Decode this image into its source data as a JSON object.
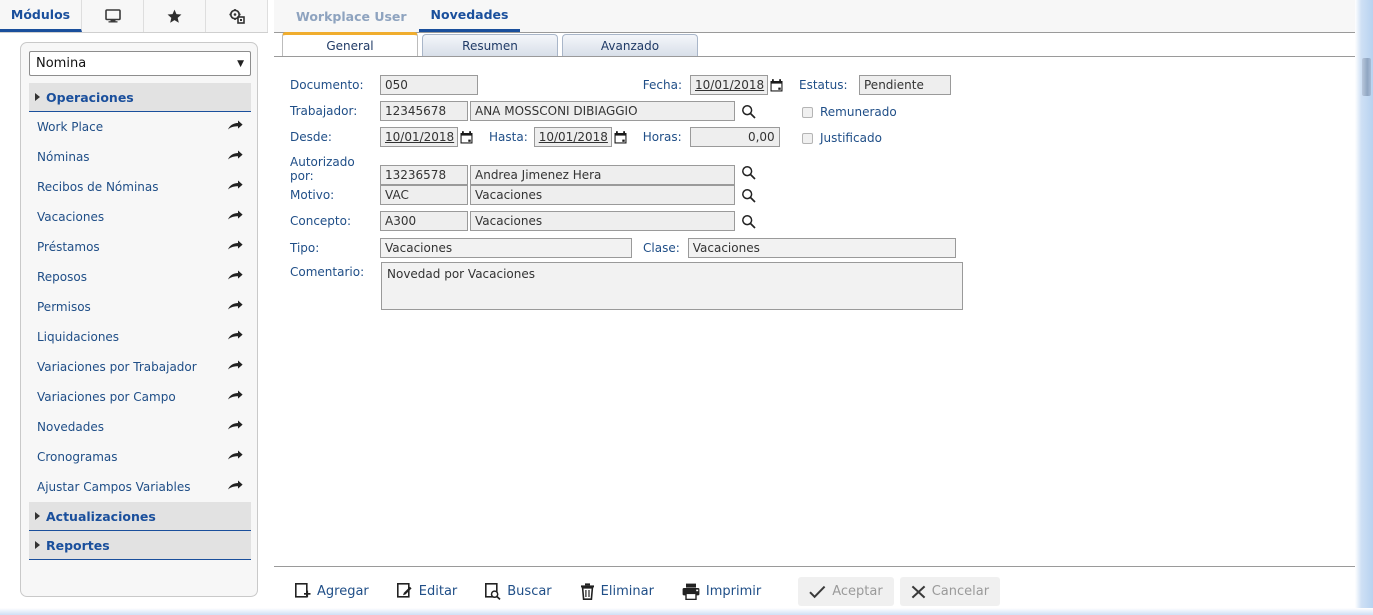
{
  "sidebar": {
    "tabs": [
      {
        "label": "Módulos",
        "icon": "modules-text",
        "active": true
      },
      {
        "label": "",
        "icon": "monitor-icon",
        "active": false
      },
      {
        "label": "",
        "icon": "star-icon",
        "active": false
      },
      {
        "label": "",
        "icon": "gears-icon",
        "active": false
      }
    ],
    "module_select": {
      "value": "Nomina",
      "caret": "▼"
    },
    "groups": [
      {
        "label": "Operaciones",
        "expanded": true
      },
      {
        "label": "Actualizaciones",
        "expanded": false
      },
      {
        "label": "Reportes",
        "expanded": false
      }
    ],
    "items": [
      {
        "label": "Work Place"
      },
      {
        "label": "Nóminas"
      },
      {
        "label": "Recibos de Nóminas"
      },
      {
        "label": "Vacaciones"
      },
      {
        "label": "Préstamos"
      },
      {
        "label": "Reposos"
      },
      {
        "label": "Permisos"
      },
      {
        "label": "Liquidaciones"
      },
      {
        "label": "Variaciones por Trabajador"
      },
      {
        "label": "Variaciones por Campo"
      },
      {
        "label": "Novedades"
      },
      {
        "label": "Cronogramas"
      },
      {
        "label": "Ajustar Campos Variables"
      }
    ]
  },
  "breadcrumbs": [
    {
      "label": "Workplace User",
      "active": false
    },
    {
      "label": "Novedades",
      "active": true
    }
  ],
  "tabs": [
    {
      "label": "General",
      "active": true
    },
    {
      "label": "Resumen",
      "active": false
    },
    {
      "label": "Avanzado",
      "active": false
    }
  ],
  "form": {
    "documento": {
      "label": "Documento:",
      "value": "050"
    },
    "fecha": {
      "label": "Fecha:",
      "value": "10/01/2018"
    },
    "estatus": {
      "label": "Estatus:",
      "value": "Pendiente"
    },
    "trabajador": {
      "label": "Trabajador:",
      "code": "12345678",
      "name": "ANA MOSSCONI DIBIAGGIO"
    },
    "desde": {
      "label": "Desde:",
      "value": "10/01/2018"
    },
    "hasta": {
      "label": "Hasta:",
      "value": "10/01/2018"
    },
    "horas": {
      "label": "Horas:",
      "value": "0,00"
    },
    "remunerado": {
      "label": "Remunerado",
      "checked": false
    },
    "justificado": {
      "label": "Justificado",
      "checked": false
    },
    "autorizado_por": {
      "label": "Autorizado por:",
      "code": "13236578",
      "name": "Andrea Jimenez Hera"
    },
    "motivo": {
      "label": "Motivo:",
      "code": "VAC",
      "name": "Vacaciones"
    },
    "concepto": {
      "label": "Concepto:",
      "code": "A300",
      "name": "Vacaciones"
    },
    "tipo": {
      "label": "Tipo:",
      "value": "Vacaciones"
    },
    "clase": {
      "label": "Clase:",
      "value": "Vacaciones"
    },
    "comentario": {
      "label": "Comentario:",
      "value": "Novedad por Vacaciones"
    }
  },
  "toolbar": [
    {
      "label": "Agregar",
      "icon": "page-plus-icon",
      "disabled": false
    },
    {
      "label": "Editar",
      "icon": "page-pencil-icon",
      "disabled": false
    },
    {
      "label": "Buscar",
      "icon": "page-search-icon",
      "disabled": false
    },
    {
      "label": "Eliminar",
      "icon": "trash-icon",
      "disabled": false
    },
    {
      "label": "Imprimir",
      "icon": "printer-icon",
      "disabled": false
    },
    {
      "label": "Aceptar",
      "icon": "check-icon",
      "disabled": true
    },
    {
      "label": "Cancelar",
      "icon": "x-icon",
      "disabled": true
    }
  ],
  "colors": {
    "accent_blue": "#1a4f9c",
    "label_blue": "#1f4e87",
    "active_tab_border": "#f0ad2e",
    "muted": "#8ea3bf",
    "field_bg": "#eeeeee"
  }
}
